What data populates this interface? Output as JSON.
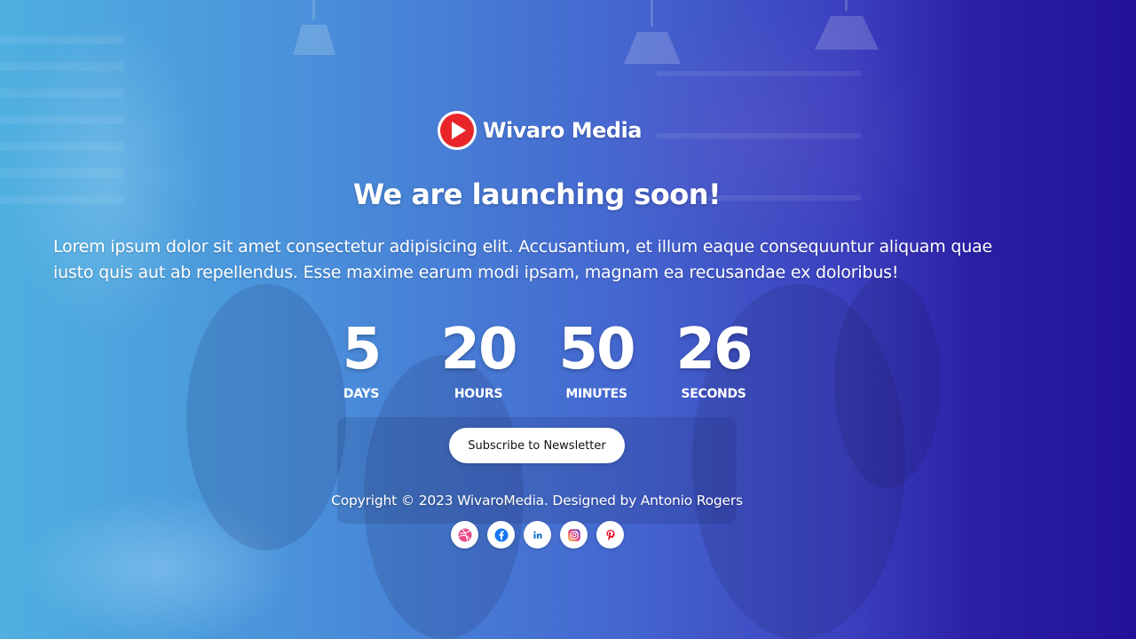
{
  "brand": {
    "name": "Wivaro Media",
    "logo_color": "#e8262a"
  },
  "hero": {
    "headline": "We are launching soon!",
    "description": "Lorem ipsum dolor sit amet consectetur adipisicing elit. Accusantium, et illum eaque consequuntur aliquam quae iusto quis aut ab repellendus. Esse maxime earum modi ipsam, magnam ea recusandae ex doloribus!"
  },
  "countdown": {
    "days": {
      "value": "5",
      "label": "DAYS"
    },
    "hours": {
      "value": "20",
      "label": "HOURS"
    },
    "minutes": {
      "value": "50",
      "label": "MINUTES"
    },
    "seconds": {
      "value": "26",
      "label": "SECONDS"
    }
  },
  "cta": {
    "subscribe_label": "Subscribe to Newsletter"
  },
  "footer": {
    "copyright": "Copyright © 2023 WivaroMedia. Designed by Antonio Rogers"
  },
  "social": [
    {
      "icon": "dribbble-icon",
      "color": "#ea4c89"
    },
    {
      "icon": "facebook-icon",
      "color": "#1877f2"
    },
    {
      "icon": "linkedin-icon",
      "color": "#0a66c2"
    },
    {
      "icon": "instagram-icon",
      "color": "#d6249f"
    },
    {
      "icon": "pinterest-icon",
      "color": "#e60023"
    }
  ],
  "theme": {
    "gradient_left": "#4fb0e0",
    "gradient_right": "#22129a"
  }
}
